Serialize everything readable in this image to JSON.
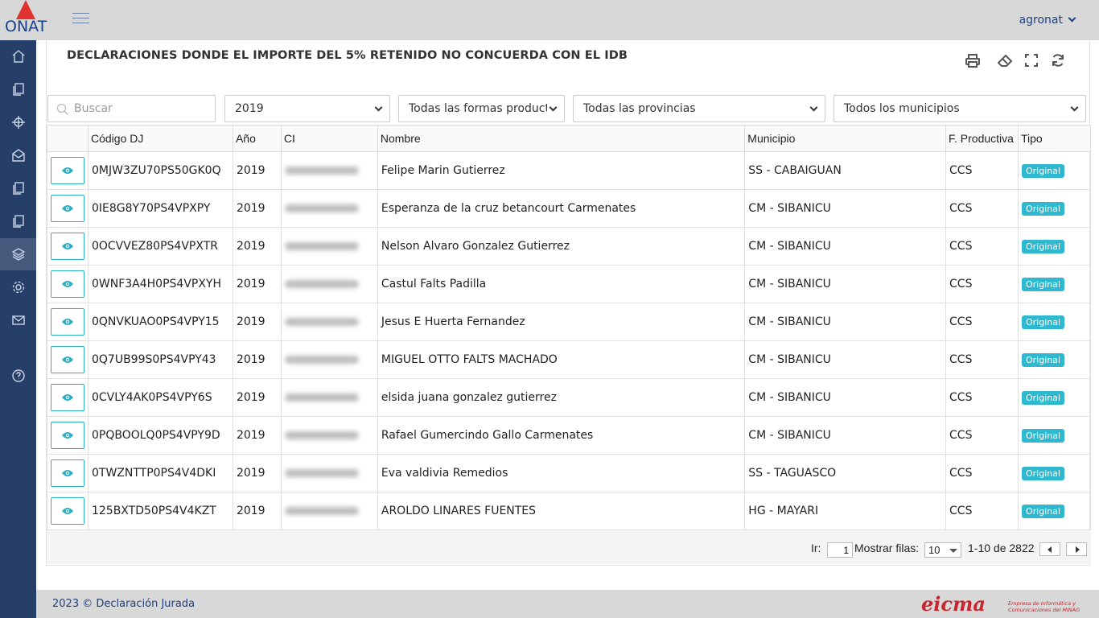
{
  "header": {
    "logo_text": "ONAT",
    "user_name": "agronat"
  },
  "sidebar": {
    "items": [
      {
        "icon": "home-icon",
        "active": false
      },
      {
        "icon": "documents-icon",
        "active": false
      },
      {
        "icon": "crosshair-icon",
        "active": false
      },
      {
        "icon": "mail-open-icon",
        "active": false
      },
      {
        "icon": "documents-icon",
        "active": false
      },
      {
        "icon": "documents-icon",
        "active": false
      },
      {
        "icon": "layers-icon",
        "active": true
      },
      {
        "icon": "gear-icon",
        "active": false
      },
      {
        "icon": "envelope-icon",
        "active": false
      },
      {
        "icon": "help-icon",
        "active": false
      }
    ]
  },
  "page": {
    "title": "DECLARACIONES DONDE EL IMPORTE DEL 5% RETENIDO NO CONCUERDA CON EL IDB",
    "toolbar": [
      "print-icon",
      "eraser-icon",
      "fullscreen-icon",
      "refresh-icon"
    ]
  },
  "filters": {
    "search_placeholder": "Buscar",
    "year": "2019",
    "forma_productiva": "Todas las formas producti",
    "provincia": "Todas las provincias",
    "municipio": "Todos los municipios"
  },
  "table": {
    "columns": [
      "",
      "Código DJ",
      "Año",
      "CI",
      "Nombre",
      "Municipio",
      "F. Productiva",
      "Tipo"
    ],
    "rows": [
      {
        "codigo": "0MJW3ZU70PS50GK0Q",
        "anio": "2019",
        "nombre": "Felipe Marin Gutierrez",
        "municipio": "SS - CABAIGUAN",
        "fp": "CCS",
        "tipo": "Original"
      },
      {
        "codigo": "0IE8G8Y70PS4VPXPY",
        "anio": "2019",
        "nombre": "Esperanza de la cruz betancourt Carmenates",
        "municipio": "CM - SIBANICU",
        "fp": "CCS",
        "tipo": "Original"
      },
      {
        "codigo": "0OCVVEZ80PS4VPXTR",
        "anio": "2019",
        "nombre": "Nelson Alvaro Gonzalez Gutierrez",
        "municipio": "CM - SIBANICU",
        "fp": "CCS",
        "tipo": "Original"
      },
      {
        "codigo": "0WNF3A4H0PS4VPXYH",
        "anio": "2019",
        "nombre": "Castul Falts Padilla",
        "municipio": "CM - SIBANICU",
        "fp": "CCS",
        "tipo": "Original"
      },
      {
        "codigo": "0QNVKUAO0PS4VPY15",
        "anio": "2019",
        "nombre": "Jesus E Huerta Fernandez",
        "municipio": "CM - SIBANICU",
        "fp": "CCS",
        "tipo": "Original"
      },
      {
        "codigo": "0Q7UB99S0PS4VPY43",
        "anio": "2019",
        "nombre": "MIGUEL OTTO FALTS MACHADO",
        "municipio": "CM - SIBANICU",
        "fp": "CCS",
        "tipo": "Original"
      },
      {
        "codigo": "0CVLY4AK0PS4VPY6S",
        "anio": "2019",
        "nombre": "elsida juana gonzalez gutierrez",
        "municipio": "CM - SIBANICU",
        "fp": "CCS",
        "tipo": "Original"
      },
      {
        "codigo": "0PQBOOLQ0PS4VPY9D",
        "anio": "2019",
        "nombre": "Rafael Gumercindo Gallo Carmenates",
        "municipio": "CM - SIBANICU",
        "fp": "CCS",
        "tipo": "Original"
      },
      {
        "codigo": "0TWZNTTP0PS4V4DKI",
        "anio": "2019",
        "nombre": "Eva valdivia Remedios",
        "municipio": "SS - TAGUASCO",
        "fp": "CCS",
        "tipo": "Original"
      },
      {
        "codigo": "125BXTD50PS4V4KZT",
        "anio": "2019",
        "nombre": "AROLDO LINARES FUENTES",
        "municipio": "HG - MAYARI",
        "fp": "CCS",
        "tipo": "Original"
      }
    ]
  },
  "pager": {
    "go_label": "Ir:",
    "page_value": "1",
    "rows_label": "Mostrar filas:",
    "rows_value": "10",
    "range_text": "1-10 de 2822"
  },
  "footer": {
    "text": "2023 © Declaración Jurada",
    "brand": "eicma",
    "brand_sub": "Empresa de Informática y Comunicaciones del MINAG"
  },
  "colors": {
    "sidebar_bg": "#263f68",
    "topbar_bg": "#d8d8d8",
    "accent": "#2fb9d1",
    "logo_red": "#e0322e",
    "logo_blue": "#1a3f8a"
  }
}
